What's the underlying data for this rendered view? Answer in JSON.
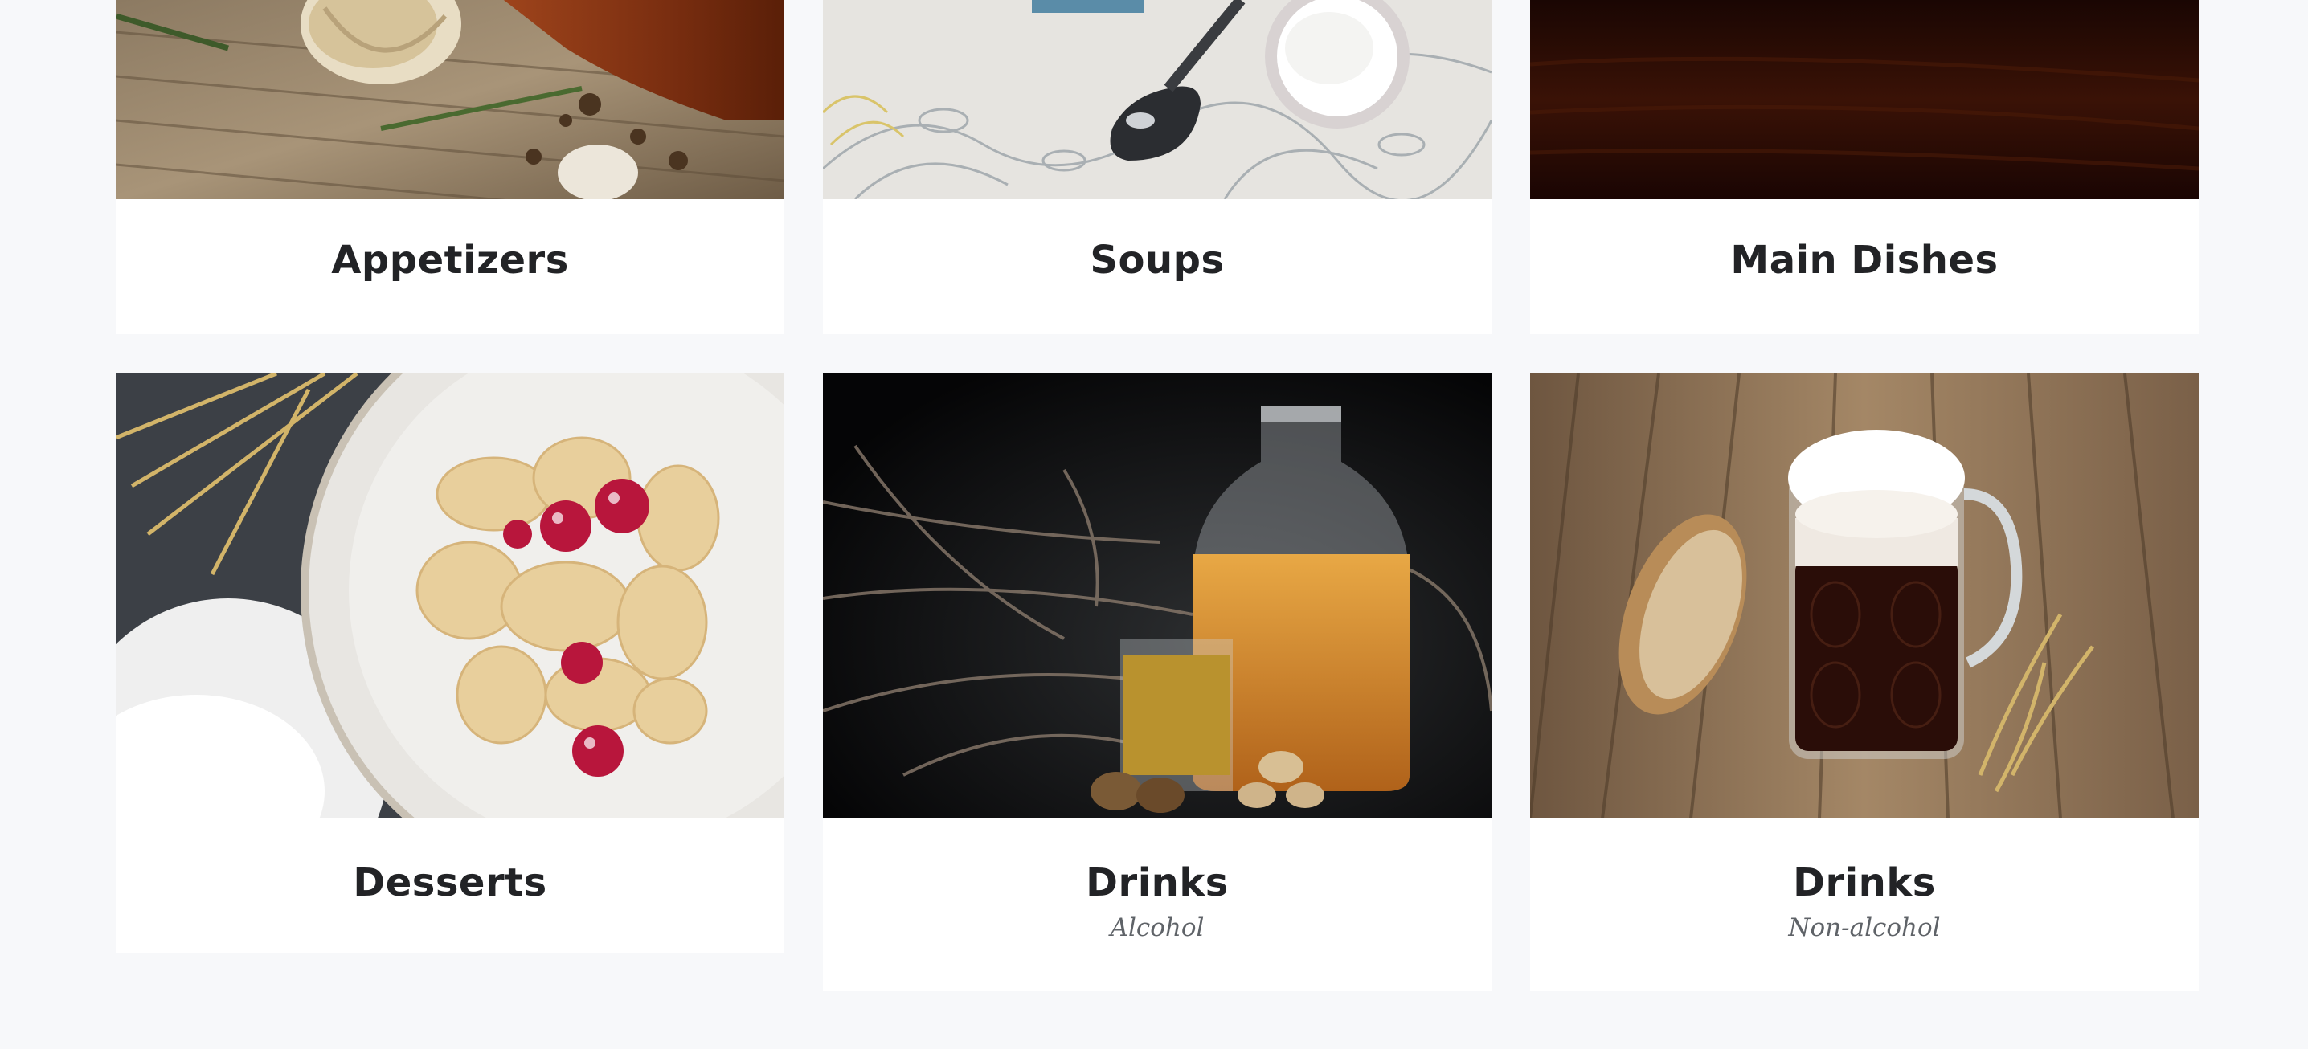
{
  "categories": [
    {
      "title": "Appetizers",
      "image": "garlic-rosemary-on-wood-photo"
    },
    {
      "title": "Soups",
      "image": "spoon-and-sour-cream-on-linen-photo"
    },
    {
      "title": "Main Dishes",
      "image": "dark-wood-photo"
    },
    {
      "title": "Desserts",
      "image": "dumplings-with-cherries-photo"
    },
    {
      "title": "Drinks",
      "subtitle": "Alcohol",
      "image": "honey-liqueur-bottle-photo"
    },
    {
      "title": "Drinks",
      "subtitle": "Non-alcohol",
      "image": "kvass-mug-with-bread-photo"
    }
  ]
}
